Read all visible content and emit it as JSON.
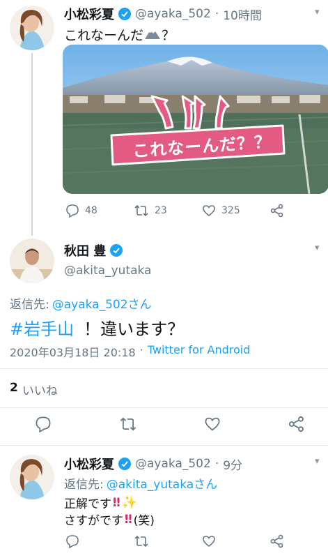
{
  "tweet1": {
    "display_name": "小松彩夏",
    "handle": "@ayaka_502",
    "sep": "·",
    "time": "10時間",
    "text": "これなーんだ",
    "text_suffix": "？",
    "image_caption": "これなーんだ？？",
    "replies": "48",
    "retweets": "23",
    "likes": "325"
  },
  "main_tweet": {
    "display_name": "秋田 豊",
    "handle": "@akita_yutaka",
    "reply_label": "返信先:",
    "reply_target": "@ayaka_502さん",
    "hashtag": "#岩手山",
    "text": "！違います？",
    "datetime": "2020年03月18日 20:18",
    "sep": "·",
    "client": "Twitter for Android",
    "likes_count": "2",
    "likes_label": "いいね"
  },
  "tweet3": {
    "display_name": "小松彩夏",
    "handle": "@ayaka_502",
    "sep": "·",
    "time": "9分",
    "reply_label": "返信先:",
    "reply_target": "@akita_yutakaさん",
    "line1": "正解です",
    "line2_a": "さすがです",
    "line2_b": "(笑)"
  },
  "colors": {
    "accent": "#1da1f2",
    "pink": "#e35a83",
    "muted": "#657786",
    "divider": "#e6ecf0"
  }
}
